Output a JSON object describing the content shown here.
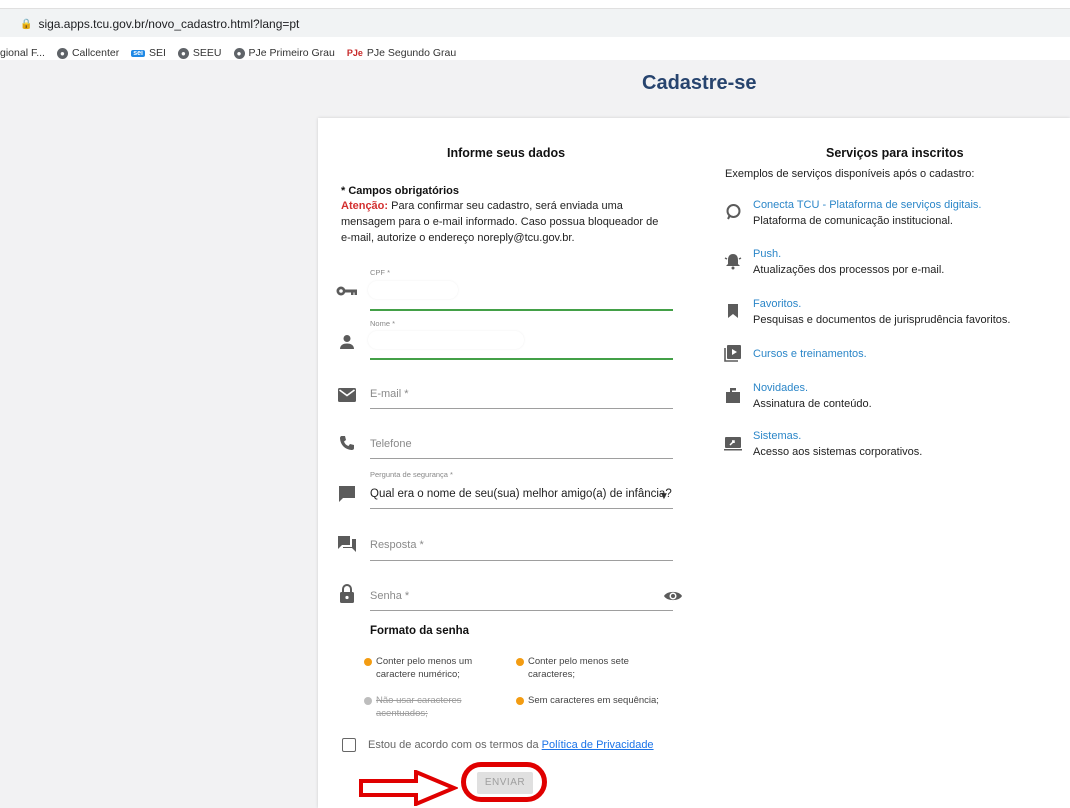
{
  "browser": {
    "url": "siga.apps.tcu.gov.br/novo_cadastro.html?lang=pt",
    "bookmarks": [
      "gional F...",
      "Callcenter",
      "SEI",
      "SEEU",
      "PJe Primeiro Grau",
      "PJe Segundo Grau"
    ]
  },
  "page": {
    "title": "Cadastre-se"
  },
  "form": {
    "heading": "Informe seus dados",
    "required_note": "* Campos obrigatórios",
    "attention_label": "Atenção:",
    "attention_text": " Para confirmar seu cadastro, será enviada uma mensagem para o e-mail informado. Caso possua bloqueador de e-mail, autorize o endereço noreply@tcu.gov.br.",
    "cpf_label": "CPF *",
    "nome_label": "Nome *",
    "email_placeholder": "E-mail *",
    "telefone_placeholder": "Telefone",
    "pergunta_label": "Pergunta de segurança *",
    "pergunta_value": "Qual era o nome de seu(sua) melhor amigo(a) de infância?",
    "resposta_placeholder": "Resposta *",
    "senha_placeholder": "Senha *",
    "password_format_title": "Formato da senha",
    "rules": [
      {
        "text": "Conter pelo menos um caractere numérico;",
        "status": "pending"
      },
      {
        "text": "Conter pelo menos sete caracteres;",
        "status": "pending"
      },
      {
        "text": "Não usar caracteres acentuados;",
        "status": "ok"
      },
      {
        "text": "Sem caracteres em sequência;",
        "status": "pending"
      }
    ],
    "agree_text": "Estou de acordo com os termos da ",
    "agree_link": "Política de Privacidade",
    "submit_label": "ENVIAR"
  },
  "services": {
    "heading": "Serviços para inscritos",
    "subtitle": "Exemplos de serviços disponíveis após o cadastro:",
    "items": [
      {
        "icon": "chat-bubble-icon",
        "link": "Conecta TCU - Plataforma de serviços digitais.",
        "desc": "Plataforma de comunicação institucional."
      },
      {
        "icon": "bell-icon",
        "link": "Push.",
        "desc": "Atualizações dos processos por e-mail."
      },
      {
        "icon": "bookmark-icon",
        "link": "Favoritos.",
        "desc": "Pesquisas e documentos de jurisprudência favoritos."
      },
      {
        "icon": "video-library-icon",
        "link": "Cursos e treinamentos.",
        "desc": ""
      },
      {
        "icon": "mailbox-icon",
        "link": "Novidades.",
        "desc": "Assinatura de conteúdo."
      },
      {
        "icon": "screen-share-icon",
        "link": "Sistemas.",
        "desc": "Acesso aos sistemas corporativos."
      }
    ]
  },
  "colors": {
    "title": "#27446e",
    "link": "#2b86c8",
    "attention": "#d32f2f",
    "valid_field": "#43a047",
    "rule_pending": "#f39c12",
    "annotation": "#e00000"
  }
}
